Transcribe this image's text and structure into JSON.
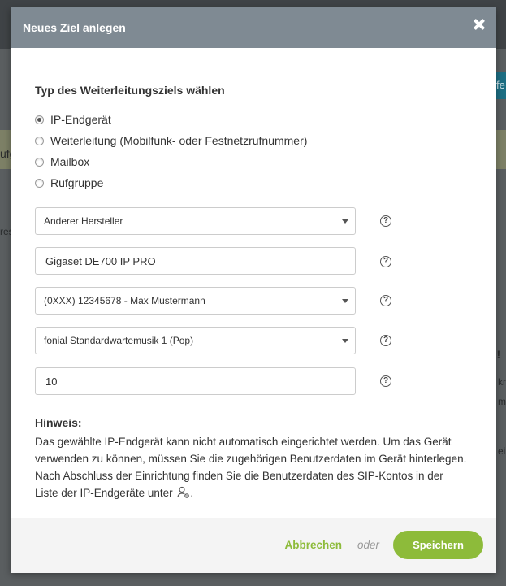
{
  "modal": {
    "title": "Neues Ziel anlegen",
    "section_title": "Typ des Weiterleitungsziels wählen",
    "radio_options": [
      {
        "label": "IP-Endgerät",
        "checked": true
      },
      {
        "label": "Weiterleitung (Mobilfunk- oder Festnetzrufnummer)",
        "checked": false
      },
      {
        "label": "Mailbox",
        "checked": false
      },
      {
        "label": "Rufgruppe",
        "checked": false
      }
    ],
    "fields": {
      "manufacturer": "Anderer Hersteller",
      "device_name": "Gigaset DE700 IP PRO",
      "phone_number": "(0XXX) 12345678 - Max Mustermann",
      "hold_music": "fonial Standardwartemusik 1 (Pop)",
      "number_value": "10"
    },
    "help_glyph": "?",
    "hint_title": "Hinweis:",
    "hint_text": "Das gewählte IP-Endgerät kann nicht automatisch eingerichtet werden. Um das Gerät verwenden zu können, müssen Sie die zugehörigen Benutzerdaten im Gerät hinterlegen. Nach Abschluss der Einrichtung finden Sie die Benutzerdaten des SIP-Kontos in der Liste der IP-Endgeräte unter",
    "hint_end": ".",
    "footer": {
      "cancel_label": "Abbrechen",
      "or_label": "oder",
      "save_label": "Speichern"
    }
  },
  "background": {
    "fragments": [
      "fe",
      "ufg",
      "res",
      "n!",
      "kn",
      "me",
      "ei"
    ]
  },
  "colors": {
    "header_bg": "#7f8a93",
    "accent_green": "#8dbb3a",
    "overlay": "#5f6365"
  }
}
